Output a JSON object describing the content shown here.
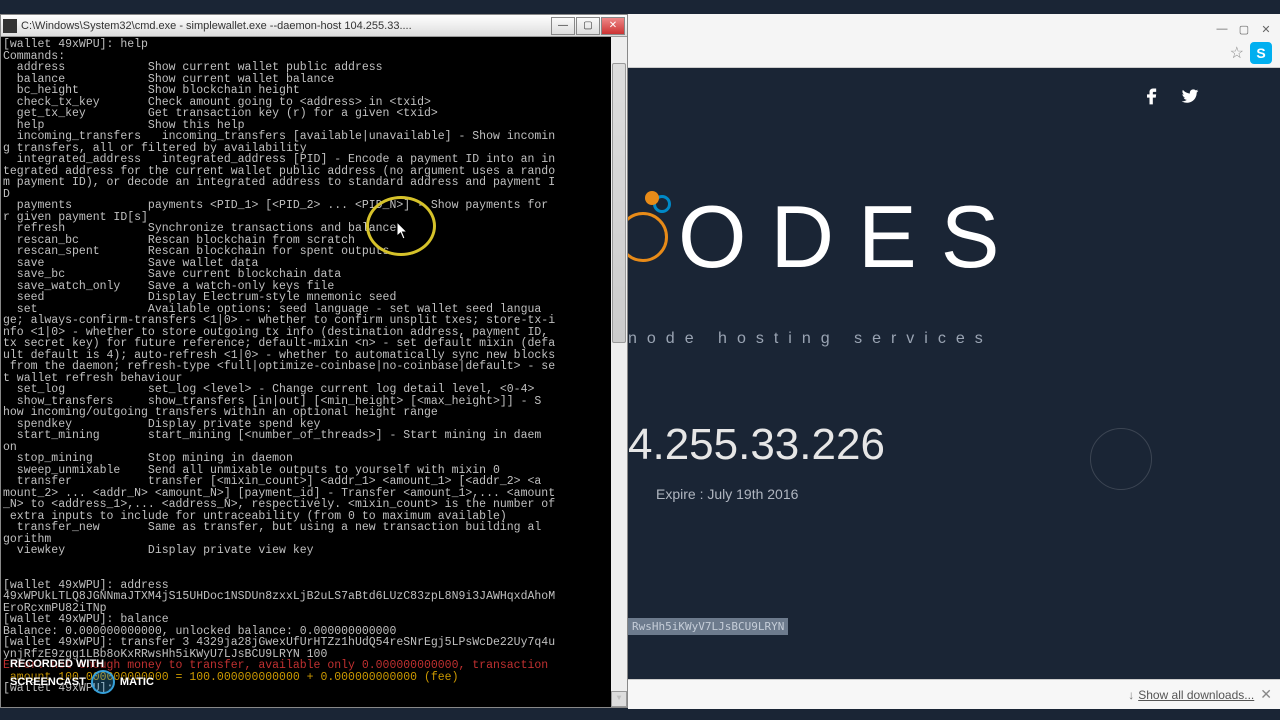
{
  "terminal": {
    "title": "C:\\Windows\\System32\\cmd.exe - simplewallet.exe  --daemon-host 104.255.33....",
    "prompt1": "[wallet 49xWPU]: help",
    "commands_header": "Commands:",
    "help_lines": [
      "  address            Show current wallet public address",
      "  balance            Show current wallet balance",
      "  bc_height          Show blockchain height",
      "  check_tx_key       Check amount going to <address> in <txid>",
      "  get_tx_key         Get transaction key (r) for a given <txid>",
      "  help               Show this help",
      "  incoming_transfers   incoming_transfers [available|unavailable] - Show incomin",
      "g transfers, all or filtered by availability",
      "  integrated_address   integrated_address [PID] - Encode a payment ID into an in",
      "tegrated address for the current wallet public address (no argument uses a rando",
      "m payment ID), or decode an integrated address to standard address and payment I",
      "D",
      "  payments           payments <PID_1> [<PID_2> ... <PID_N>] - Show payments for",
      "r given payment ID[s]",
      "  refresh            Synchronize transactions and balance",
      "  rescan_bc          Rescan blockchain from scratch",
      "  rescan_spent       Rescan blockchain for spent outputs",
      "  save               Save wallet data",
      "  save_bc            Save current blockchain data",
      "  save_watch_only    Save a watch-only keys file",
      "  seed               Display Electrum-style mnemonic seed",
      "  set                Available options: seed language - set wallet seed langua",
      "ge; always-confirm-transfers <1|0> - whether to confirm unsplit txes; store-tx-i",
      "nfo <1|0> - whether to store outgoing tx info (destination address, payment ID,",
      "tx secret key) for future reference; default-mixin <n> - set default mixin (defa",
      "ult default is 4); auto-refresh <1|0> - whether to automatically sync new blocks",
      " from the daemon; refresh-type <full|optimize-coinbase|no-coinbase|default> - se",
      "t wallet refresh behaviour",
      "  set_log            set_log <level> - Change current log detail level, <0-4>",
      "  show_transfers     show_transfers [in|out] [<min_height> [<max_height>]] - S",
      "how incoming/outgoing transfers within an optional height range",
      "  spendkey           Display private spend key",
      "  start_mining       start_mining [<number_of_threads>] - Start mining in daem",
      "on",
      "  stop_mining        Stop mining in daemon",
      "  sweep_unmixable    Send all unmixable outputs to yourself with mixin 0",
      "  transfer           transfer [<mixin_count>] <addr_1> <amount_1> [<addr_2> <a",
      "mount_2> ... <addr_N> <amount_N>] [payment_id] - Transfer <amount_1>,... <amount",
      "_N> to <address_1>,... <address_N>, respectively. <mixin_count> is the number of",
      " extra inputs to include for untraceability (from 0 to maximum available)",
      "  transfer_new       Same as transfer, but using a new transaction building al",
      "gorithm",
      "  viewkey            Display private view key",
      "",
      ""
    ],
    "prompt2": "[wallet 49xWPU]: address",
    "address_out": "49xWPUkLTLQ8JGNNmaJTXM4jS15UHDoc1NSDUn8zxxLjB2uLS7aBtd6LUzC83zpL8N9i3JAWHqxdAhoM",
    "address_out2": "EroRcxmPU82iTNp",
    "prompt3": "[wallet 49xWPU]: balance",
    "balance_out": "Balance: 0.000000000000, unlocked balance: 0.000000000000",
    "prompt4": "[wallet 49xWPU]: transfer 3 4329ja28jGwexUfUrHTZz1hUdQ54reSNrEgj5LPsWcDe22Uy7q4u",
    "transfer_line2": "ynjRfzE9zgg1LBb8oKxRRwsHh5iKWyU7LJsBCU9LRYN 100",
    "error_line1": "Error: not enough money to transfer, available only 0.000000000000, transaction",
    "error_line2": " amount 100.000000000000 = 100.000000000000 + 0.000000000000 (fee)",
    "prompt5": "[wallet 49xWPU]:"
  },
  "browser": {
    "brand": "ODES",
    "tagline": "node hosting services",
    "ip": "4.255.33.226",
    "expire": "Expire : July 19th 2016",
    "selection": "RwsHh5iKWyV7LJsBCU9LRYN",
    "showall": "Show all downloads..."
  },
  "watermark": {
    "line1": "RECORDED WITH",
    "line2_a": "SCREENCAST",
    "line2_b": "MATIC"
  }
}
